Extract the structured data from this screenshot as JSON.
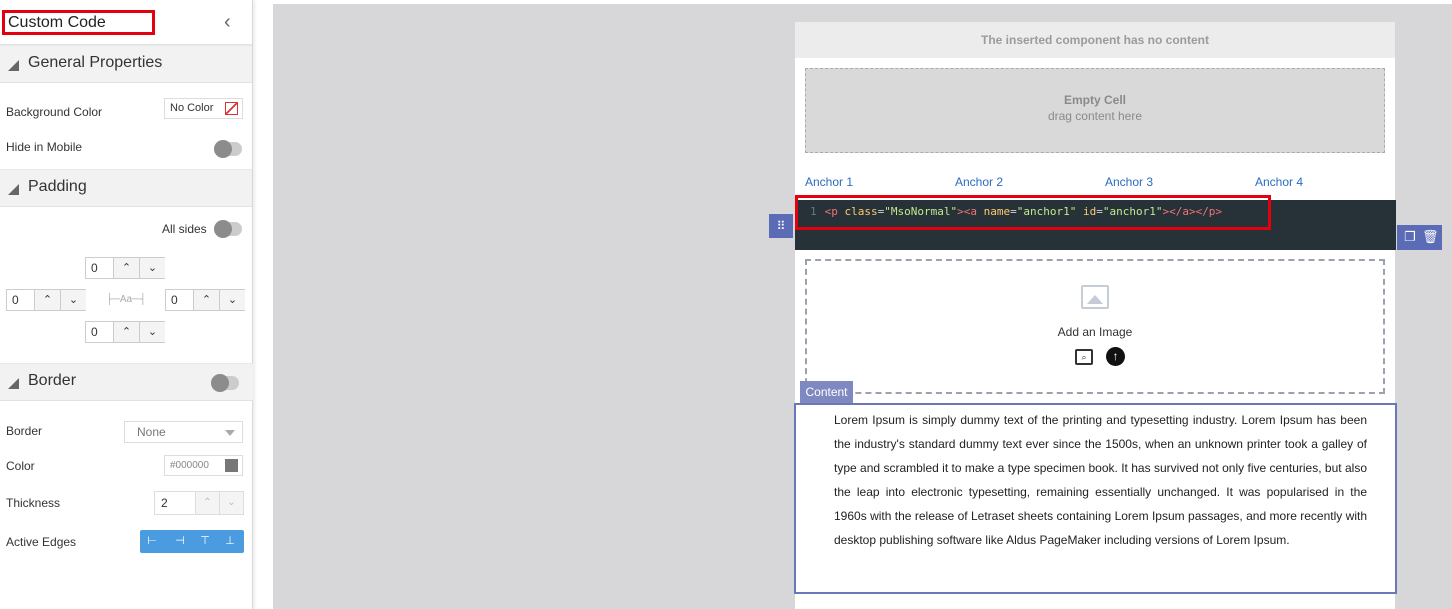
{
  "panel": {
    "title": "Custom Code",
    "general": {
      "title": "General Properties",
      "background_color_label": "Background Color",
      "background_color_value": "No Color",
      "hide_in_mobile_label": "Hide in Mobile"
    },
    "padding": {
      "title": "Padding",
      "all_sides_label": "All sides",
      "top": "0",
      "left": "0",
      "right": "0",
      "bottom": "0",
      "center_glyph": "Aa"
    },
    "border": {
      "title": "Border",
      "border_label": "Border",
      "border_value": "None",
      "color_label": "Color",
      "color_value": "#000000",
      "thickness_label": "Thickness",
      "thickness_value": "2",
      "active_edges_label": "Active Edges"
    }
  },
  "canvas": {
    "no_content_msg": "The inserted component has no content",
    "empty_cell": {
      "title": "Empty Cell",
      "subtitle": "drag content here"
    },
    "anchors": [
      "Anchor 1",
      "Anchor 2",
      "Anchor 3",
      "Anchor 4"
    ],
    "code": {
      "line_number": "1",
      "parts": [
        "<p ",
        "class",
        "=",
        "\"MsoNormal\"",
        "><a ",
        "name",
        "=",
        "\"anchor1\"",
        " ",
        "id",
        "=",
        "\"anchor1\"",
        "></a></p>"
      ]
    },
    "image": {
      "label": "Add an Image"
    },
    "content_tag": "Content",
    "content_text": "Lorem Ipsum is simply dummy text of the printing and typesetting industry. Lorem Ipsum has been the industry's standard dummy text ever since the 1500s, when an unknown printer took a galley of type and scrambled it to make a type specimen book. It has survived not only five centuries, but also the leap into electronic typesetting, remaining essentially unchanged. It was popularised in the 1960s with the release of Letraset sheets containing Lorem Ipsum passages, and more recently with desktop publishing software like Aldus PageMaker including versions of Lorem Ipsum."
  },
  "colors": {
    "accent_blue": "#4a9be0",
    "highlight_red": "#e3000f",
    "code_bg": "#263238",
    "selection_purple": "#5b6bb5"
  }
}
